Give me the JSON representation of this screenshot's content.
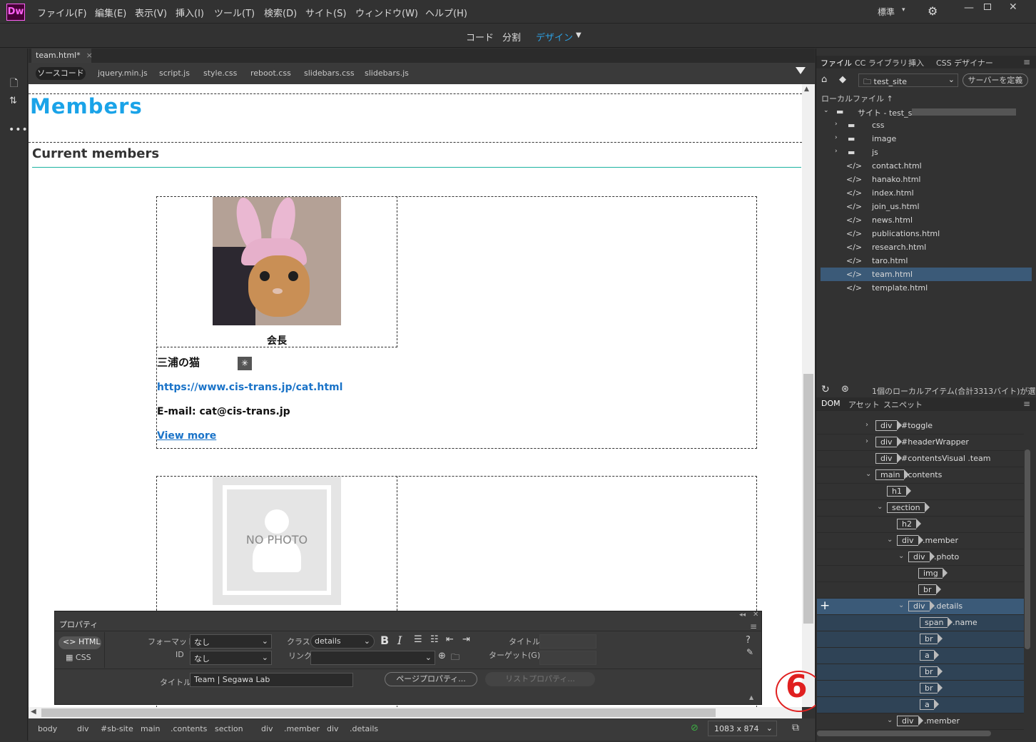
{
  "app": {
    "logo": "Dw",
    "workspace": "標準"
  },
  "menu": [
    "ファイル(F)",
    "編集(E)",
    "表示(V)",
    "挿入(I)",
    "ツール(T)",
    "検索(D)",
    "サイト(S)",
    "ウィンドウ(W)",
    "ヘルプ(H)"
  ],
  "views": {
    "code": "コード",
    "split": "分割",
    "design": "デザイン"
  },
  "doc_tab": "team.html*",
  "related_files": [
    "ソースコード",
    "jquery.min.js",
    "script.js",
    "style.css",
    "reboot.css",
    "slidebars.css",
    "slidebars.js"
  ],
  "page": {
    "h1": "Members",
    "h2": "Current members",
    "member1": {
      "caption": "会長",
      "name": "三浦の猫",
      "url": "https://www.cis-trans.jp/cat.html",
      "email": "E-mail: cat@cis-trans.jp",
      "more": "View more"
    },
    "member2": {
      "photo_text": "NO PHOTO"
    }
  },
  "properties": {
    "title": "プロパティ",
    "html": "HTML",
    "css": "CSS",
    "format_label": "フォーマット",
    "format_value": "なし",
    "id_label": "ID",
    "id_value": "なし",
    "class_label": "クラス",
    "class_value": "details",
    "link_label": "リンク",
    "title_label": "タイトル",
    "target_label": "ターゲット(G)",
    "page_title_label": "タイトル",
    "page_title": "Team | Segawa Lab",
    "page_props": "ページプロパティ...",
    "list_props": "リストプロパティ..."
  },
  "status": {
    "crumbs": [
      "body",
      "div",
      "#sb-site",
      "main",
      ".contents",
      "section",
      "div",
      ".member",
      "div",
      ".details"
    ],
    "size": "1083 x 874"
  },
  "annotation": "6",
  "files_panel": {
    "tabs": [
      "ファイル",
      "CC ライブラリ",
      "挿入",
      "CSS デザイナー"
    ],
    "site": "test_site",
    "define_server": "サーバーを定義",
    "local_label": "ローカルファイル ↑",
    "root": "サイト - test_sit",
    "folders": [
      "css",
      "image",
      "js"
    ],
    "files": [
      "contact.html",
      "hanako.html",
      "index.html",
      "join_us.html",
      "news.html",
      "publications.html",
      "research.html",
      "taro.html",
      "team.html",
      "template.html"
    ],
    "status_text": "1個のローカルアイテム(合計3313バイト)が選..."
  },
  "dom_panel": {
    "tabs": [
      "DOM",
      "アセット",
      "スニペット"
    ],
    "rows": [
      {
        "tag": "div",
        "sel": "#toggle"
      },
      {
        "tag": "div",
        "sel": "#headerWrapper"
      },
      {
        "tag": "div",
        "sel": "#contentsVisual .team"
      },
      {
        "tag": "main",
        "sel": ".contents"
      },
      {
        "tag": "h1",
        "sel": ""
      },
      {
        "tag": "section",
        "sel": ""
      },
      {
        "tag": "h2",
        "sel": ""
      },
      {
        "tag": "div",
        "sel": ".member"
      },
      {
        "tag": "div",
        "sel": ".photo"
      },
      {
        "tag": "img",
        "sel": ""
      },
      {
        "tag": "br",
        "sel": ""
      },
      {
        "tag": "div",
        "sel": ".details"
      },
      {
        "tag": "span",
        "sel": ".name"
      },
      {
        "tag": "br",
        "sel": ""
      },
      {
        "tag": "a",
        "sel": ""
      },
      {
        "tag": "br",
        "sel": ""
      },
      {
        "tag": "br",
        "sel": ""
      },
      {
        "tag": "a",
        "sel": ""
      },
      {
        "tag": "div",
        "sel": ".member"
      }
    ]
  },
  "colors": {
    "accent": "#2d9fe0",
    "h1": "#1aa3e8",
    "teal": "#1bb3a0",
    "link": "#1a73c8",
    "selection": "#3b5a78"
  }
}
